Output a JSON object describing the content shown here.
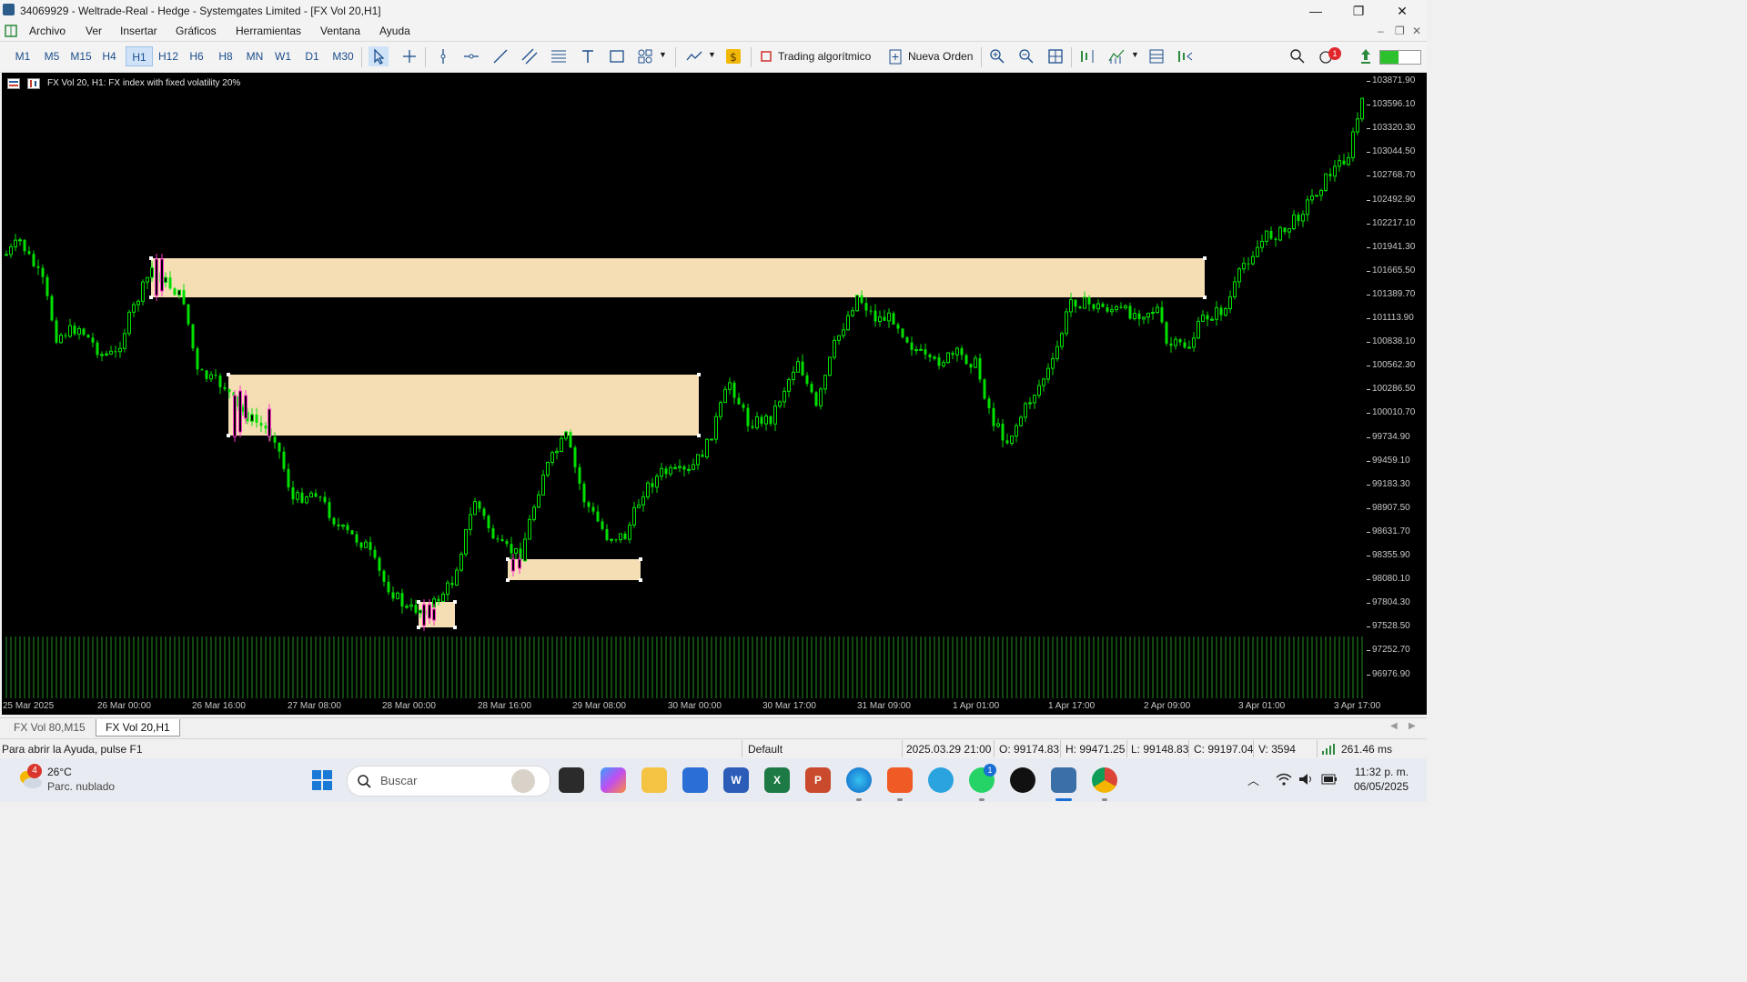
{
  "window": {
    "title": "34069929 - Weltrade-Real - Hedge - Systemgates Limited - [FX Vol 20,H1]",
    "minimize_glyph": "—",
    "maximize_glyph": "❐",
    "close_glyph": "✕"
  },
  "menu": {
    "items": [
      "Archivo",
      "Ver",
      "Insertar",
      "Gráficos",
      "Herramientas",
      "Ventana",
      "Ayuda"
    ]
  },
  "toolbar": {
    "timeframes": [
      "M1",
      "M5",
      "M15",
      "H4",
      "H1",
      "H12",
      "H6",
      "H8",
      "MN",
      "W1",
      "D1",
      "M30"
    ],
    "active_timeframe": "H1",
    "algo_trading_label": "Trading algorítmico",
    "new_order_label": "Nueva Orden",
    "notification_count": "1"
  },
  "chart": {
    "info": "FX Vol 20, H1:  FX index with fixed volatility 20%",
    "price_labels": [
      "103871.90",
      "103596.10",
      "103320.30",
      "103044.50",
      "102768.70",
      "102492.90",
      "102217.10",
      "101941.30",
      "101665.50",
      "101389.70",
      "101113.90",
      "100838.10",
      "100562.30",
      "100286.50",
      "100010.70",
      "99734.90",
      "99459.10",
      "99183.30",
      "98907.50",
      "98631.70",
      "98355.90",
      "98080.10",
      "97804.30",
      "97528.50",
      "97252.70",
      "96976.90"
    ],
    "time_labels": [
      "25 Mar 2025",
      "26 Mar 00:00",
      "26 Mar 16:00",
      "27 Mar 08:00",
      "28 Mar 00:00",
      "28 Mar 16:00",
      "29 Mar 08:00",
      "30 Mar 00:00",
      "30 Mar 17:00",
      "31 Mar 09:00",
      "1 Apr 01:00",
      "1 Apr 17:00",
      "2 Apr 09:00",
      "3 Apr 01:00",
      "3 Apr 17:00"
    ],
    "colors": {
      "background": "#000000",
      "bull": "#00e000",
      "bear": "#00e000",
      "zone": "#f5deb3",
      "magenta": "#ff33cc",
      "volume": "#1f8f1f"
    }
  },
  "tabs": [
    "FX Vol 80,M15",
    "FX Vol 20,H1"
  ],
  "active_tab": "FX Vol 20,H1",
  "status": {
    "help": "Para abrir la Ayuda, pulse F1",
    "profile": "Default",
    "datetime": "2025.03.29 21:00",
    "open": "O: 99174.83",
    "high": "H: 99471.25",
    "low": "L: 99148.83",
    "close": "C: 99197.04",
    "volume": "V: 3594",
    "ping": "261.46 ms"
  },
  "taskbar": {
    "weather_temp": "26°C",
    "weather_desc": "Parc. nublado",
    "weather_badge": "4",
    "search_placeholder": "Buscar",
    "whatsapp_badge": "1",
    "clock_time": "11:32 p. m.",
    "clock_date": "06/05/2025"
  }
}
